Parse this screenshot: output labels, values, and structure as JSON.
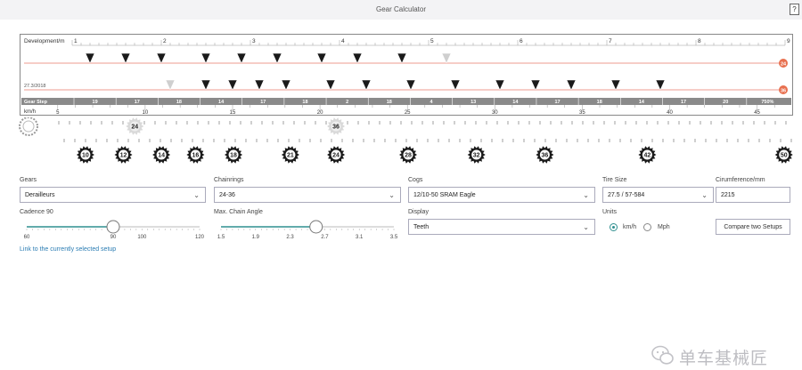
{
  "window": {
    "title": "Gear Calculator",
    "help_label": "?"
  },
  "chart_data": {
    "type": "scatter",
    "xlabel_top": "Development/m",
    "x_top_ticks": [
      1,
      2,
      3,
      4,
      5,
      6,
      7,
      8,
      9
    ],
    "x_top_range": [
      1,
      9
    ],
    "row1": {
      "label": "",
      "marks": [
        1.2,
        1.6,
        2.0,
        2.5,
        2.9,
        3.3,
        3.8,
        4.2,
        4.7
      ],
      "ghost_marks": [
        5.2
      ],
      "chainring": "24"
    },
    "row2": {
      "label": "27.3/2018",
      "marks": [
        2.5,
        2.8,
        3.1,
        3.4,
        3.9,
        4.3,
        4.8,
        5.3,
        5.8,
        6.2,
        6.6,
        7.1,
        7.6
      ],
      "ghost_marks": [
        2.1
      ],
      "chainring": "36"
    },
    "gearstep_label": "Gear Step",
    "gearstep_values": [
      "19",
      "17",
      "18",
      "14",
      "17",
      "18",
      "2",
      "18",
      "4",
      "13",
      "14",
      "17",
      "18",
      "14",
      "17",
      "20",
      "750%"
    ],
    "speed_label": "km/h",
    "speed_ticks": [
      5,
      10,
      15,
      20,
      25,
      30,
      35,
      40,
      45
    ],
    "speed_range": [
      4.5,
      46.5
    ]
  },
  "gears": {
    "chainrings": [
      {
        "teeth": "24",
        "pos": 0.14,
        "faded": true
      },
      {
        "teeth": "36",
        "pos": 0.405,
        "faded": true
      }
    ],
    "cogs": [
      {
        "teeth": "10",
        "pos": 0.075
      },
      {
        "teeth": "12",
        "pos": 0.125
      },
      {
        "teeth": "14",
        "pos": 0.175
      },
      {
        "teeth": "16",
        "pos": 0.22
      },
      {
        "teeth": "18",
        "pos": 0.27
      },
      {
        "teeth": "21",
        "pos": 0.345
      },
      {
        "teeth": "24",
        "pos": 0.405
      },
      {
        "teeth": "28",
        "pos": 0.5
      },
      {
        "teeth": "32",
        "pos": 0.59
      },
      {
        "teeth": "36",
        "pos": 0.68
      },
      {
        "teeth": "42",
        "pos": 0.815
      },
      {
        "teeth": "50",
        "pos": 0.995
      }
    ]
  },
  "form": {
    "gears_label": "Gears",
    "gears_value": "Derailleurs",
    "chainrings_label": "Chainrings",
    "chainrings_value": "24-36",
    "cogs_label": "Cogs",
    "cogs_value": "12/10-50 SRAM Eagle",
    "tire_label": "Tire Size",
    "tire_value": "27.5 / 57-584",
    "circ_label": "Cirumference/mm",
    "circ_value": "2215",
    "cadence_label": "Cadence 90",
    "cadence": {
      "min": 60,
      "max": 120,
      "value": 90,
      "ticks": [
        "60",
        "90",
        "100",
        "120"
      ]
    },
    "chain_angle_label": "Max. Chain Angle",
    "chain_angle": {
      "min": 1.5,
      "max": 3.5,
      "value": 2.6,
      "ticks": [
        "1.5",
        "1.9",
        "2.3",
        "2.7",
        "3.1",
        "3.5"
      ]
    },
    "display_label": "Display",
    "display_value": "Teeth",
    "units_label": "Units",
    "unit_kmh": "km/h",
    "unit_mph": "Mph",
    "compare_button": "Compare two Setups",
    "link_text": "Link to the currently selected setup"
  },
  "watermark": {
    "text": "单车基械匠"
  },
  "colors": {
    "accent": "#2f8f8f",
    "line_red": "#e87a6a",
    "marker": "#1a1a1a",
    "badge": "#e8704f",
    "bar": "#8a8a8a"
  }
}
